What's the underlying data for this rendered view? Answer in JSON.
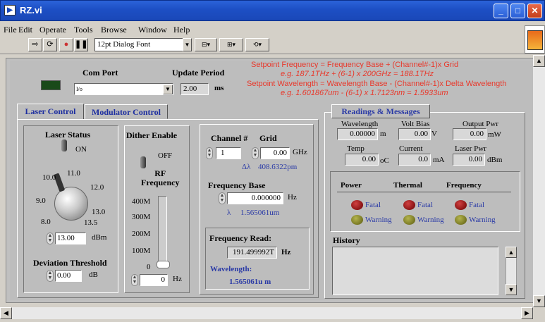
{
  "window": {
    "title": "RZ.vi",
    "min_label": "_",
    "max_label": "□",
    "close_label": "✕"
  },
  "menu": [
    {
      "label": "File"
    },
    {
      "label": "Edit"
    },
    {
      "label": "Operate"
    },
    {
      "label": "Tools"
    },
    {
      "label": "Browse"
    },
    {
      "label": "Window"
    },
    {
      "label": "Help"
    }
  ],
  "toolbar": {
    "font": "12pt Dialog Font"
  },
  "formula": {
    "line1": "Setpoint Frequency = Frequency Base + (Channel#-1)x Grid",
    "line2": "e.g. 187.1THz + (6-1) x 200GHz = 188.1THz",
    "line3": "Setpoint Wavelength = Wavelength Base - (Channel#-1)x Delta Wavelength",
    "line4": "e.g. 1.601867um - (6-1) x 1.7123nm = 1.5933um"
  },
  "com_port": {
    "label": "Com Port",
    "value": "",
    "prefix": "I/o"
  },
  "update_period": {
    "label": "Update Period",
    "value": "2.00",
    "unit": "ms"
  },
  "tabs": [
    {
      "label": "Laser Control"
    },
    {
      "label": "Modulator Control"
    }
  ],
  "laser_status": {
    "label": "Laser Status",
    "value": "ON"
  },
  "dither": {
    "label": "Dither Enable",
    "value": "OFF"
  },
  "knob": {
    "ticks": [
      "10.0",
      "11.0",
      "12.0",
      "9.0",
      "13.0",
      "8.0",
      "13.5"
    ],
    "value": "13.00",
    "unit": "dBm"
  },
  "deviation": {
    "label": "Deviation Threshold",
    "value": "0.00",
    "unit": "dB"
  },
  "rf": {
    "label": "RF\nFrequency",
    "ticks": [
      "400M",
      "300M",
      "200M",
      "100M",
      "0"
    ],
    "value": "0",
    "unit": "Hz"
  },
  "channel": {
    "label": "Channel #",
    "value": "1"
  },
  "grid": {
    "label": "Grid",
    "value": "0.00",
    "unit": "GHz",
    "delta_symbol": "Δλ",
    "delta_value": "408.6322pm"
  },
  "freq_base": {
    "label": "Frequency Base",
    "value": "0.000000",
    "unit": "Hz",
    "lambda_symbol": "λ",
    "lambda_value": "1.565061um"
  },
  "freq_read": {
    "label": "Frequency Read:",
    "value": "191.499992T",
    "unit": "Hz",
    "wl_label": "Wavelength:",
    "wl_value": "1.565061u m"
  },
  "readings": {
    "title": "Readings & Messages",
    "wavelength": {
      "label": "Wavelength",
      "value": "0.00000",
      "unit": "m"
    },
    "volt_bias": {
      "label": "Volt Bias",
      "value": "0.00",
      "unit": "V"
    },
    "output_pwr": {
      "label": "Output Pwr",
      "value": "0.00",
      "unit": "mW"
    },
    "temp": {
      "label": "Temp",
      "value": "0.00",
      "unit": "oC"
    },
    "current": {
      "label": "Current",
      "value": "0.0",
      "unit": "mA"
    },
    "laser_pwr": {
      "label": "Laser Pwr",
      "value": "0.00",
      "unit": "dBm"
    }
  },
  "alarms": {
    "headers": [
      "Power",
      "Thermal",
      "Frequency"
    ],
    "fatal": "Fatal",
    "warning": "Warning",
    "fatal_color": "#b01010",
    "warning_color": "#8a8a20"
  },
  "history": {
    "label": "History"
  }
}
